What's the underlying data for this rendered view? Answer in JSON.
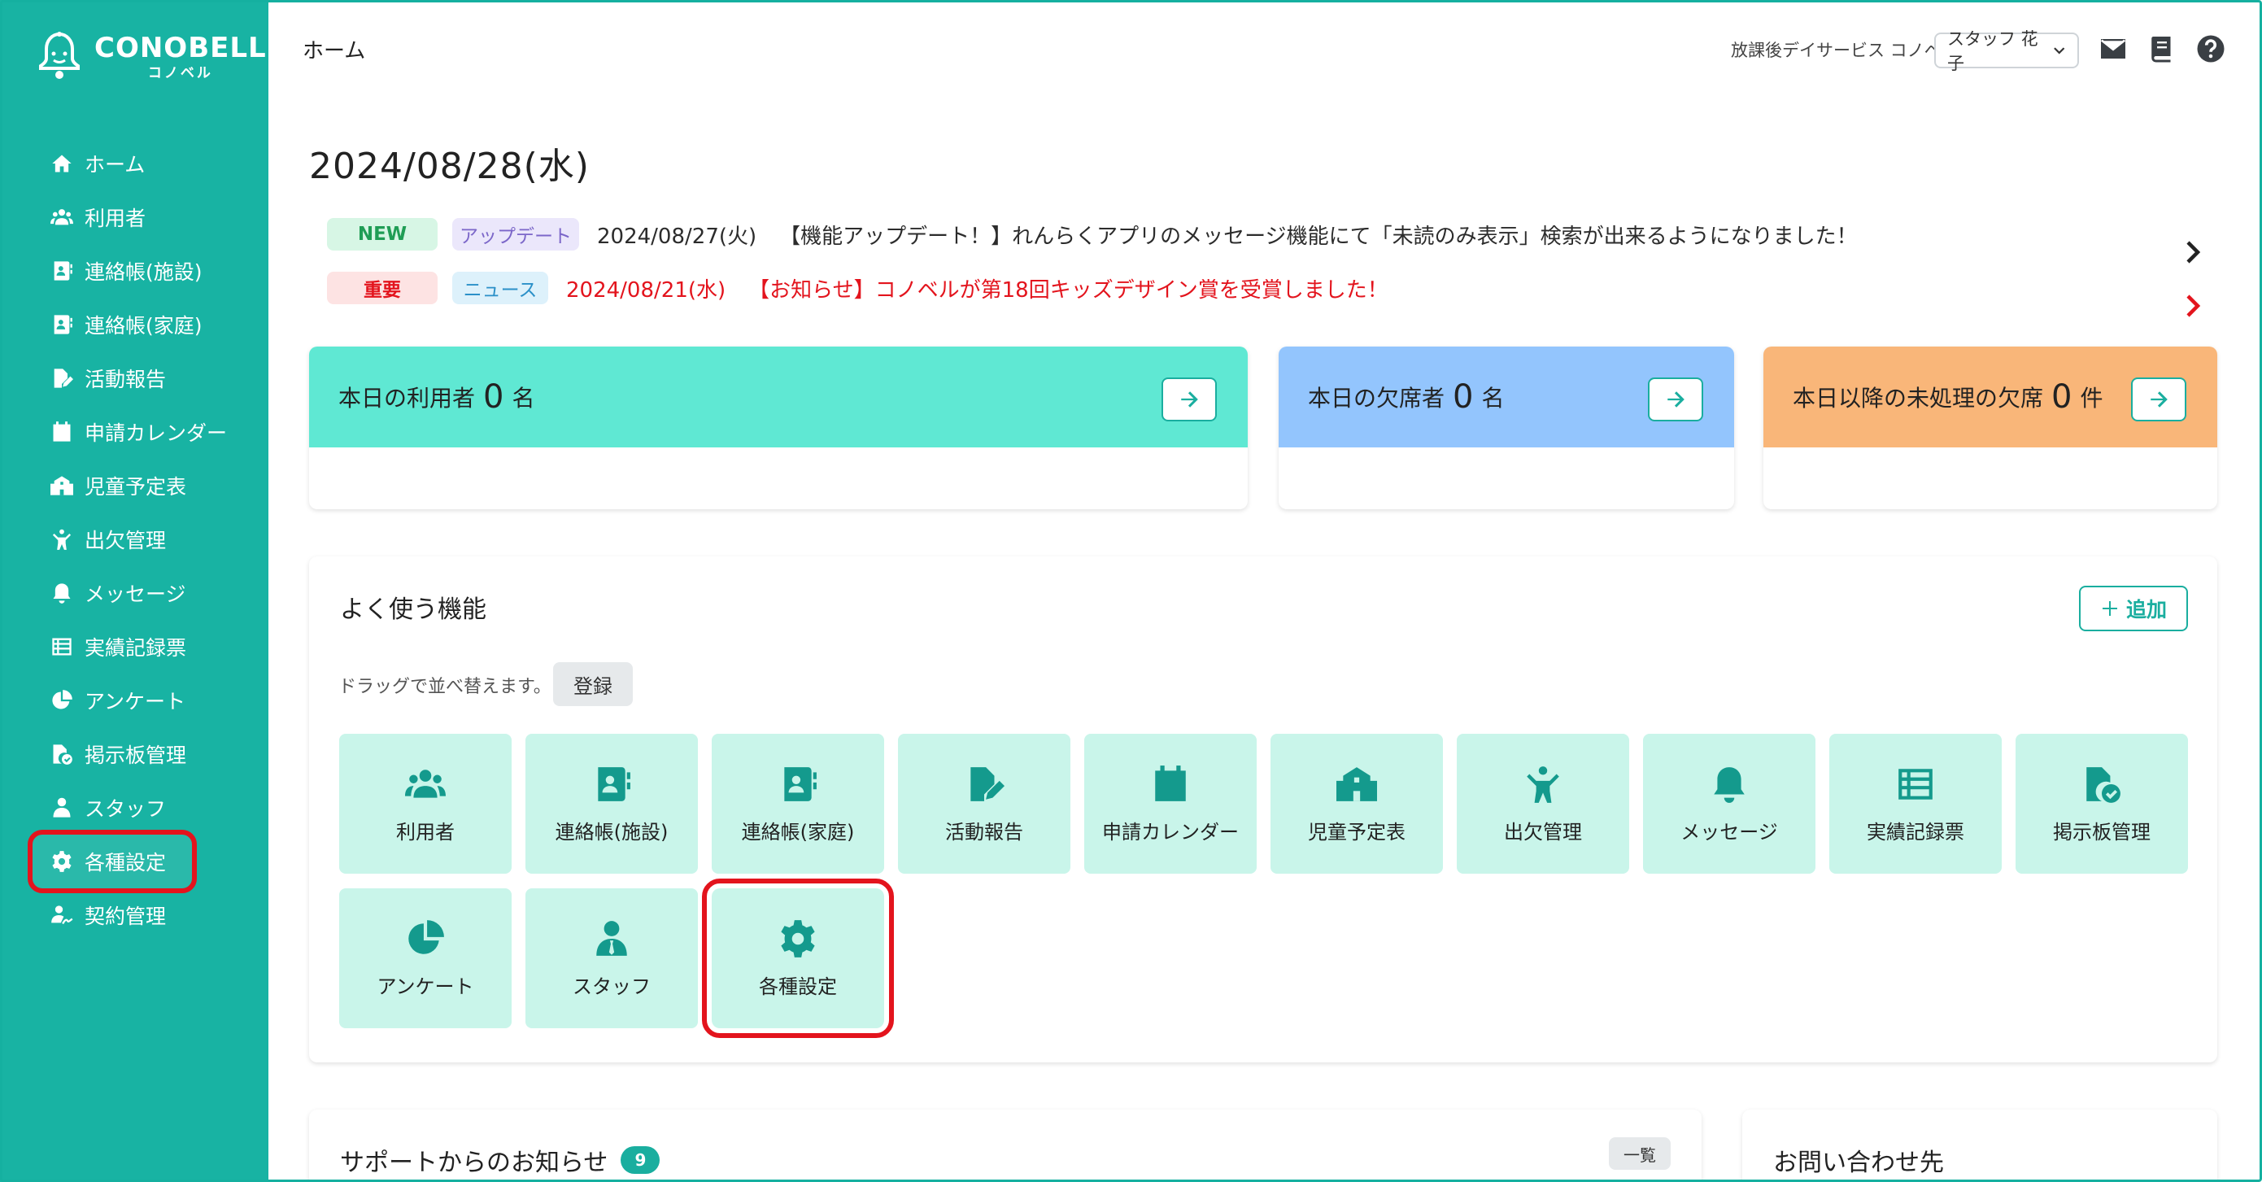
{
  "brand": {
    "name": "CONOBELL",
    "subname": "コノベル"
  },
  "sidebar": {
    "items": [
      {
        "label": "ホーム",
        "icon": "home-icon"
      },
      {
        "label": "利用者",
        "icon": "users-icon"
      },
      {
        "label": "連絡帳(施設)",
        "icon": "contact-book-icon"
      },
      {
        "label": "連絡帳(家庭)",
        "icon": "contact-book-icon"
      },
      {
        "label": "活動報告",
        "icon": "report-icon"
      },
      {
        "label": "申請カレンダー",
        "icon": "calendar-icon"
      },
      {
        "label": "児童予定表",
        "icon": "school-icon"
      },
      {
        "label": "出欠管理",
        "icon": "person-icon"
      },
      {
        "label": "メッセージ",
        "icon": "bell-icon"
      },
      {
        "label": "実績記録票",
        "icon": "table-icon"
      },
      {
        "label": "アンケート",
        "icon": "pie-chart-icon"
      },
      {
        "label": "掲示板管理",
        "icon": "file-check-icon"
      },
      {
        "label": "スタッフ",
        "icon": "staff-icon"
      },
      {
        "label": "各種設定",
        "icon": "gear-icon"
      },
      {
        "label": "契約管理",
        "icon": "contract-icon"
      }
    ],
    "active_index": 13
  },
  "header": {
    "breadcrumb": "ホーム",
    "facility": "放課後デイサービス コノベル",
    "staff": "スタッフ 花子"
  },
  "date": "2024/08/28(水)",
  "news": [
    {
      "badge1": "NEW",
      "badge2": "アップデート",
      "date": "2024/08/27(火)",
      "text": "【機能アップデート！】れんらくアプリのメッセージ機能にて「未読のみ表示」検索が出来るようになりました！"
    },
    {
      "badge1": "重要",
      "badge2": "ニュース",
      "date": "2024/08/21(水)",
      "text": "【お知らせ】コノベルが第18回キッズデザイン賞を受賞しました！"
    }
  ],
  "stats": [
    {
      "label": "本日の利用者",
      "value": "0",
      "unit": "名",
      "color": "#5fe8d3"
    },
    {
      "label": "本日の欠席者",
      "value": "0",
      "unit": "名",
      "color": "#93c5fd"
    },
    {
      "label": "本日以降の未処理の欠席",
      "value": "0",
      "unit": "件",
      "color": "#f9b679"
    }
  ],
  "favorites": {
    "title": "よく使う機能",
    "add_label": "追加",
    "drag_hint": "ドラッグで並べ替えます。",
    "register_label": "登録",
    "tiles": [
      "利用者",
      "連絡帳(施設)",
      "連絡帳(家庭)",
      "活動報告",
      "申請カレンダー",
      "児童予定表",
      "出欠管理",
      "メッセージ",
      "実績記録票",
      "掲示板管理",
      "アンケート",
      "スタッフ",
      "各種設定"
    ]
  },
  "support": {
    "title": "サポートからのお知らせ",
    "count": "9",
    "list_label": "一覧"
  },
  "contact": {
    "title": "お問い合わせ先"
  },
  "colors": {
    "primary": "#18b3a3",
    "tile_bg": "#c9f5ea",
    "highlight": "#e3141d"
  }
}
